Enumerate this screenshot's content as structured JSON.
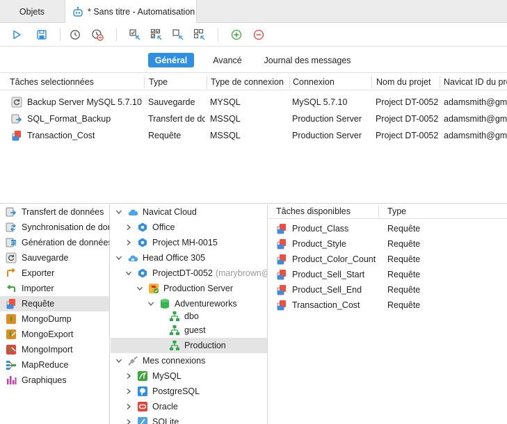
{
  "tabs": {
    "objects_label": "Objets",
    "active_label": "* Sans titre - Automatisation"
  },
  "toolbar": {
    "buttons": [
      "play-icon",
      "save-icon",
      "clock-icon",
      "clock-remove-icon",
      "select-icon",
      "select-all-icon",
      "deselect-icon",
      "deselect-all-icon",
      "add-icon",
      "remove-icon"
    ],
    "accent": "#2f8fe3",
    "add_color": "#3aa53a",
    "remove_color": "#e0443a"
  },
  "segments": [
    "Général",
    "Avancé",
    "Journal des messages"
  ],
  "selected_tasks": {
    "columns": [
      "Tâches selectionnées",
      "Type",
      "Type de connexion",
      "Connexion",
      "Nom du projet",
      "Navicat ID du projet"
    ],
    "rows": [
      {
        "icon": "backup-icon",
        "name": "Backup Server MySQL 5.7.10",
        "type": "Sauvegarde",
        "conn_type": "MYSQL",
        "connection": "MySQL 5.7.10",
        "project": "Project DT-0052",
        "navicat_id": "adamsmith@gmail.com"
      },
      {
        "icon": "transfer-icon",
        "name": "SQL_Format_Backup",
        "type": "Transfert de données",
        "conn_type": "MSSQL",
        "connection": "Production Server",
        "project": "Project DT-0052",
        "navicat_id": "adamsmith@gmail.com"
      },
      {
        "icon": "query-icon",
        "name": "Transaction_Cost",
        "type": "Requête",
        "conn_type": "MSSQL",
        "connection": "Production Server",
        "project": "Project DT-0052",
        "navicat_id": "adamsmith@gmail.com"
      }
    ]
  },
  "categories": [
    {
      "icon": "transfer-icon",
      "label": "Transfert de données"
    },
    {
      "icon": "sync-icon",
      "label": "Synchronisation de données"
    },
    {
      "icon": "data-generation-icon",
      "label": "Génération de données"
    },
    {
      "icon": "backup-icon",
      "label": "Sauvegarde"
    },
    {
      "icon": "export-icon",
      "label": "Exporter"
    },
    {
      "icon": "import-icon",
      "label": "Importer"
    },
    {
      "icon": "query-icon",
      "label": "Requête",
      "selected": true
    },
    {
      "icon": "mongodump-icon",
      "label": "MongoDump"
    },
    {
      "icon": "mongoexport-icon",
      "label": "MongoExport"
    },
    {
      "icon": "mongoimport-icon",
      "label": "MongoImport"
    },
    {
      "icon": "mapreduce-icon",
      "label": "MapReduce"
    },
    {
      "icon": "charts-icon",
      "label": "Graphiques"
    }
  ],
  "tree": [
    {
      "icon": "cloud-icon",
      "label": "Navicat Cloud",
      "chevron": "none"
    },
    {
      "icon": "project-icon",
      "label": "Office",
      "chevron": "right"
    },
    {
      "icon": "project-icon",
      "label": "Project MH-0015",
      "chevron": "right"
    },
    {
      "icon": "cloud-icon",
      "label": "Head Office 305",
      "chevron": "none"
    },
    {
      "icon": "project-icon",
      "label": "ProjectDT-0052",
      "suffix": "(marybrown@gmail.com)",
      "chevron": "down"
    },
    {
      "icon": "sqlserver-icon",
      "label": "Production Server",
      "chevron": "down"
    },
    {
      "icon": "database-icon",
      "label": "Adventureworks",
      "chevron": "down"
    },
    {
      "icon": "schema-icon",
      "label": "dbo",
      "chevron": "none"
    },
    {
      "icon": "schema-icon",
      "label": "guest",
      "chevron": "none"
    },
    {
      "icon": "schema-icon",
      "label": "Production",
      "chevron": "none",
      "selected": true
    },
    {
      "icon": "connections-icon",
      "label": "Mes connexions",
      "chevron": "none"
    },
    {
      "icon": "mysql-icon",
      "label": "MySQL",
      "chevron": "right"
    },
    {
      "icon": "postgresql-icon",
      "label": "PostgreSQL",
      "chevron": "right"
    },
    {
      "icon": "oracle-icon",
      "label": "Oracle",
      "chevron": "right"
    },
    {
      "icon": "sqlite-icon",
      "label": "SQLite",
      "chevron": "right"
    }
  ],
  "available_tasks": {
    "columns": [
      "Tâches disponibles",
      "Type"
    ],
    "rows": [
      {
        "icon": "query-icon",
        "name": "Product_Class",
        "type": "Requête"
      },
      {
        "icon": "query-icon",
        "name": "Product_Style",
        "type": "Requête"
      },
      {
        "icon": "query-icon",
        "name": "Product_Color_Count",
        "type": "Requête"
      },
      {
        "icon": "query-icon",
        "name": "Product_Sell_Start",
        "type": "Requête"
      },
      {
        "icon": "query-icon",
        "name": "Product_Sell_End",
        "type": "Requête"
      },
      {
        "icon": "query-icon",
        "name": "Transaction_Cost",
        "type": "Requête"
      }
    ]
  }
}
